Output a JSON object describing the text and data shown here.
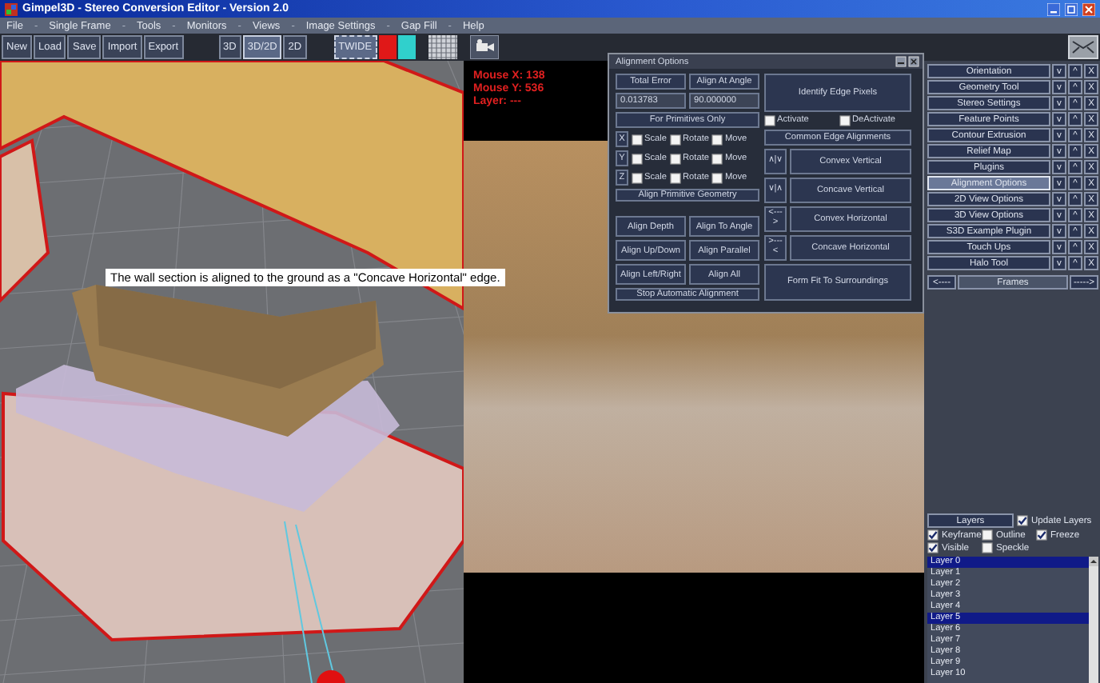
{
  "window": {
    "title": "Gimpel3D - Stereo Conversion Editor - Version 2.0"
  },
  "menu": [
    {
      "kind": "item",
      "label": "File"
    },
    {
      "kind": "separator",
      "label": "-"
    },
    {
      "kind": "item",
      "label": "Single Frame"
    },
    {
      "kind": "separator",
      "label": "-"
    },
    {
      "kind": "item",
      "label": "Tools"
    },
    {
      "kind": "separator",
      "label": "-"
    },
    {
      "kind": "item",
      "label": "Monitors"
    },
    {
      "kind": "separator",
      "label": "-"
    },
    {
      "kind": "item",
      "label": "Views"
    },
    {
      "kind": "separator",
      "label": "-"
    },
    {
      "kind": "item",
      "label": "Image Settings"
    },
    {
      "kind": "separator",
      "label": "-"
    },
    {
      "kind": "item",
      "label": "Gap Fill"
    },
    {
      "kind": "separator",
      "label": "-"
    },
    {
      "kind": "item",
      "label": "Help"
    }
  ],
  "toolbar": {
    "file_buttons": [
      "New",
      "Load",
      "Save",
      "Import",
      "Export"
    ],
    "view_modes": [
      {
        "label": "3D",
        "selected": false
      },
      {
        "label": "3D/2D",
        "selected": true
      },
      {
        "label": "2D",
        "selected": false
      }
    ],
    "wide_button": "TWIDE",
    "swatches": [
      {
        "color": "#e01818"
      },
      {
        "color": "#30d0cc"
      }
    ]
  },
  "viewport_3d": {
    "caption": "The wall section is aligned to the ground as a \"Concave Horizontal\" edge."
  },
  "viewport_2d": {
    "readouts": [
      "Mouse X: 138",
      "Mouse Y: 536",
      "Layer: ---"
    ]
  },
  "alignment_dialog": {
    "title": "Alignment Options",
    "total_error_label": "Total Error",
    "align_angle_label": "Align At Angle",
    "total_error_value": "0.013783",
    "angle_value": "90.000000",
    "identify_button": "Identify Edge Pixels",
    "toggles": [
      {
        "label": "Activate",
        "checked": false
      },
      {
        "label": "DeActivate",
        "checked": false
      }
    ],
    "primitives_header": "For Primitives Only",
    "edge_header": "Common Edge Alignments",
    "axes": [
      {
        "axis": "X",
        "options": [
          {
            "label": "Scale",
            "checked": false
          },
          {
            "label": "Rotate",
            "checked": false
          },
          {
            "label": "Move",
            "checked": false
          }
        ]
      },
      {
        "axis": "Y",
        "options": [
          {
            "label": "Scale",
            "checked": false
          },
          {
            "label": "Rotate",
            "checked": false
          },
          {
            "label": "Move",
            "checked": false
          }
        ]
      },
      {
        "axis": "Z",
        "options": [
          {
            "label": "Scale",
            "checked": false
          },
          {
            "label": "Rotate",
            "checked": false
          },
          {
            "label": "Move",
            "checked": false
          }
        ]
      }
    ],
    "geometry_button": "Align Primitive Geometry",
    "align_buttons": [
      "Align Depth",
      "Align To Angle",
      "Align Up/Down",
      "Align Parallel",
      "Align Left/Right",
      "Align All"
    ],
    "stop_button": "Stop Automatic Alignment",
    "edges": [
      {
        "symbol": "∧|∨",
        "label": "Convex Vertical"
      },
      {
        "symbol": "∨|∧",
        "label": "Concave Vertical"
      },
      {
        "symbol": "<--->",
        "label": "Convex Horizontal"
      },
      {
        "symbol": ">---<",
        "label": "Concave Horizontal"
      }
    ],
    "form_fit_button": "Form Fit To Surroundings"
  },
  "tools": [
    {
      "label": "Orientation",
      "selected": false,
      "buttons": [
        "v",
        "^",
        "X"
      ]
    },
    {
      "label": "Geometry Tool",
      "selected": false,
      "buttons": [
        "v",
        "^",
        "X"
      ]
    },
    {
      "label": "Stereo Settings",
      "selected": false,
      "buttons": [
        "v",
        "^",
        "X"
      ]
    },
    {
      "label": "Feature Points",
      "selected": false,
      "buttons": [
        "v",
        "^",
        "X"
      ]
    },
    {
      "label": "Contour Extrusion",
      "selected": false,
      "buttons": [
        "v",
        "^",
        "X"
      ]
    },
    {
      "label": "Relief Map",
      "selected": false,
      "buttons": [
        "v",
        "^",
        "X"
      ]
    },
    {
      "label": "Plugins",
      "selected": false,
      "buttons": [
        "v",
        "^",
        "X"
      ]
    },
    {
      "label": "Alignment Options",
      "selected": true,
      "buttons": [
        "v",
        "^",
        "X"
      ]
    },
    {
      "label": "2D View Options",
      "selected": false,
      "buttons": [
        "v",
        "^",
        "X"
      ]
    },
    {
      "label": "3D View Options",
      "selected": false,
      "buttons": [
        "v",
        "^",
        "X"
      ]
    },
    {
      "label": "S3D Example Plugin",
      "selected": false,
      "buttons": [
        "v",
        "^",
        "X"
      ]
    },
    {
      "label": "Touch Ups",
      "selected": false,
      "buttons": [
        "v",
        "^",
        "X"
      ]
    },
    {
      "label": "Halo Tool",
      "selected": false,
      "buttons": [
        "v",
        "^",
        "X"
      ]
    }
  ],
  "frames": {
    "prev": "<----",
    "label": "Frames",
    "next": "----->"
  },
  "layers": {
    "header": "Layers",
    "update": {
      "label": "Update Layers",
      "checked": true
    },
    "options": [
      {
        "label": "Keyframe",
        "checked": true
      },
      {
        "label": "Outline",
        "checked": false
      },
      {
        "label": "Freeze",
        "checked": true
      },
      {
        "label": "Visible",
        "checked": true
      },
      {
        "label": "Speckle",
        "checked": false
      }
    ],
    "items": [
      {
        "label": "Layer 0",
        "selected": true
      },
      {
        "label": "Layer 1",
        "selected": false
      },
      {
        "label": "Layer 2",
        "selected": false
      },
      {
        "label": "Layer 3",
        "selected": false
      },
      {
        "label": "Layer 4",
        "selected": false
      },
      {
        "label": "Layer 5",
        "selected": true
      },
      {
        "label": "Layer 6",
        "selected": false
      },
      {
        "label": "Layer 7",
        "selected": false
      },
      {
        "label": "Layer 8",
        "selected": false
      },
      {
        "label": "Layer 9",
        "selected": false
      },
      {
        "label": "Layer 10",
        "selected": false
      }
    ]
  }
}
